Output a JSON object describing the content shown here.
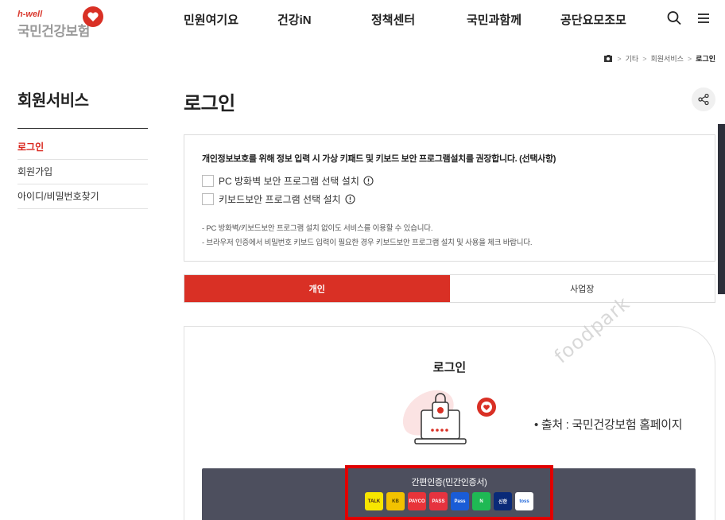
{
  "header": {
    "logo_sub": "h-well",
    "logo_main": "국민건강보험",
    "gnb": [
      "민원여기요",
      "건강iN",
      "정책센터",
      "국민과함께",
      "공단요모조모"
    ],
    "search_icon": "search-icon",
    "menu_icon": "hamburger-menu-icon"
  },
  "breadcrumb": {
    "items": [
      "기타",
      "회원서비스"
    ],
    "current": "로그인"
  },
  "sidebar": {
    "title": "회원서비스",
    "items": [
      "로그인",
      "회원가입",
      "아이디/비밀번호찾기"
    ],
    "active_index": 0
  },
  "main": {
    "title": "로그인",
    "security": {
      "title": "개인정보보호를 위해 정보 입력 시 가상 키패드 및 키보드 보안 프로그램설치를 권장합니다. (선택사항)",
      "options": [
        "PC 방화벽 보안 프로그램 선택 설치",
        "키보드보안 프로그램 선택 설치"
      ],
      "notes": [
        "- PC 방화벽/키보드보안 프로그램 설치 없이도 서비스를 이용할 수 있습니다.",
        "- 브라우저 인증에서 비밀번호 키보드 입력이 필요한 경우 키보드보안 프로그램 설치 및 사용을 체크 바랍니다."
      ]
    },
    "tabs": [
      "개인",
      "사업장"
    ],
    "active_tab": 0,
    "login_card": {
      "title": "로그인",
      "watermark": "foodpark",
      "source": "• 출처 : 국민건강보험 홈페이지",
      "easy_auth_label": "간편인증(민간인증서)",
      "providers": [
        {
          "name": "TALK",
          "color": "#f7e600",
          "text_color": "#3c1e1e"
        },
        {
          "name": "KB",
          "color": "#f2c200",
          "text_color": "#4a3a00"
        },
        {
          "name": "PAYCO",
          "color": "#e8343a",
          "text_color": "#ffffff"
        },
        {
          "name": "PASS",
          "color": "#e6333f",
          "text_color": "#ffffff"
        },
        {
          "name": "Pass",
          "color": "#1a5cd6",
          "text_color": "#ffffff"
        },
        {
          "name": "N",
          "color": "#1fb954",
          "text_color": "#ffffff"
        },
        {
          "name": "신한",
          "color": "#0a2a78",
          "text_color": "#ffffff"
        },
        {
          "name": "toss",
          "color": "#ffffff",
          "text_color": "#1b64da"
        }
      ]
    }
  },
  "colors": {
    "accent": "#d93025",
    "highlight": "#e00000",
    "easy_bar": "#4d4f5e"
  }
}
